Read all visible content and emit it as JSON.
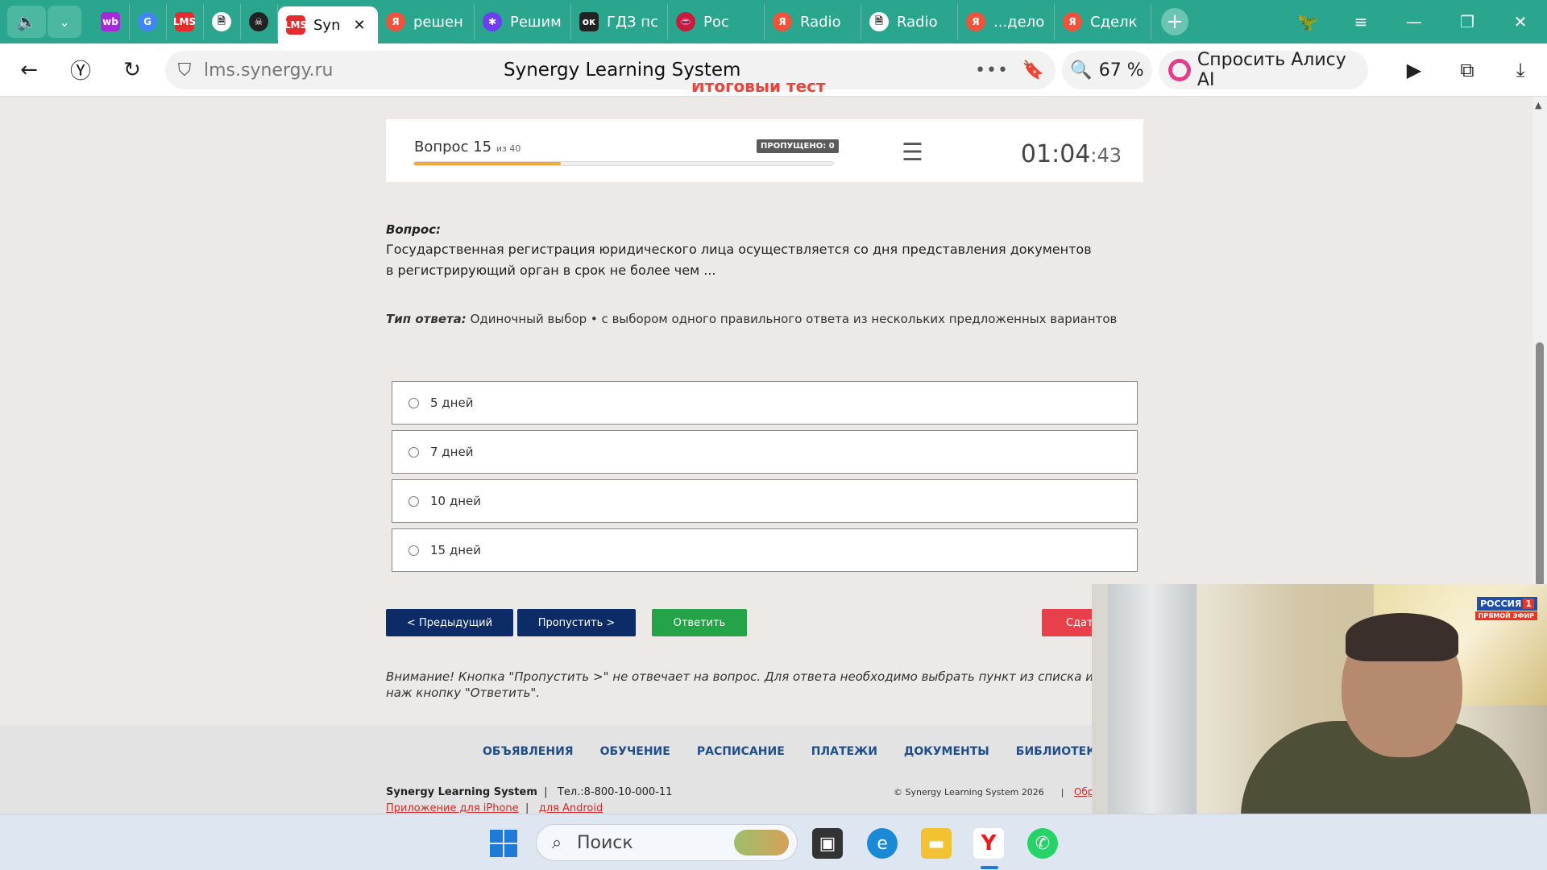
{
  "browser": {
    "tabs": [
      {
        "label": "",
        "favicon": "wb",
        "color": "#a629d9"
      },
      {
        "label": "",
        "favicon": "G",
        "color": "#4285f4"
      },
      {
        "label": "",
        "favicon": "LMS",
        "color": "#e52b2b"
      },
      {
        "label": "",
        "favicon": "doc",
        "color": "#ffffff"
      },
      {
        "label": "",
        "favicon": "pirate",
        "color": "#222222"
      },
      {
        "label": "Syn",
        "favicon": "LMS",
        "color": "#e52b2b",
        "active": true
      },
      {
        "label": "решен",
        "favicon": "Я",
        "color": "#f0523a"
      },
      {
        "label": "Решим",
        "favicon": "✱",
        "color": "#6e3ff2"
      },
      {
        "label": "ГДЗ пс",
        "favicon": "ок",
        "color": "#222222"
      },
      {
        "label": "Рос",
        "favicon": "lips",
        "color": "#c41d3b"
      },
      {
        "label": "Radio",
        "favicon": "Я",
        "color": "#f0523a"
      },
      {
        "label": "Radio",
        "favicon": "doc",
        "color": "#ffffff"
      },
      {
        "label": "...дело",
        "favicon": "Я",
        "color": "#f0523a"
      },
      {
        "label": "Сделк",
        "favicon": "Я",
        "color": "#f0523a"
      }
    ],
    "domain": "lms.synergy.ru",
    "page_title": "Synergy Learning System",
    "zoom": "67 %",
    "alice_label": "Спросить Алису AI"
  },
  "quiz": {
    "title_cut": "Итоговый тест",
    "question_label": "Вопрос 15",
    "question_of": "из 40",
    "progress": 0.35,
    "skipped": "ПРОПУЩЕНО: 0",
    "timer_main": "01:04",
    "timer_sec": ":43",
    "q_heading": "Вопрос:",
    "q_text": "Государственная регистрация юридического лица осуществляется со дня представления документов в регистрирующий орган в срок не более чем ...",
    "type_label": "Тип ответа:",
    "type_text": "Одиночный выбор • с выбором одного правильного ответа из нескольких предложенных вариантов",
    "answers": [
      "5 дней",
      "7 дней",
      "10 дней",
      "15 дней"
    ],
    "btn_prev": "< Предыдущий",
    "btn_skip": "Пропустить >",
    "btn_answer": "Ответить",
    "btn_submit": "Сдат",
    "warning": "Внимание! Кнопка \"Пропустить >\" не отвечает на вопрос. Для ответа необходимо выбрать пункт из списка и наж кнопку \"Ответить\"."
  },
  "footer": {
    "nav": [
      "ОБЪЯВЛЕНИЯ",
      "ОБУЧЕНИЕ",
      "РАСПИСАНИЕ",
      "ПЛАТЕЖИ",
      "ДОКУМЕНТЫ",
      "БИБЛИОТЕКА"
    ],
    "brand": "Synergy Learning System",
    "phone": "Тел.:8-800-10-000-11",
    "iphone": "Приложение для iPhone",
    "android": "для Android",
    "copyright": "© Synergy Learning System 2026",
    "cut_link": "Обр"
  },
  "video": {
    "channel": "РОССИЯ",
    "channel_num": "1",
    "live": "ПРЯМОЙ ЭФИР"
  },
  "taskbar": {
    "search_placeholder": "Поиск"
  }
}
